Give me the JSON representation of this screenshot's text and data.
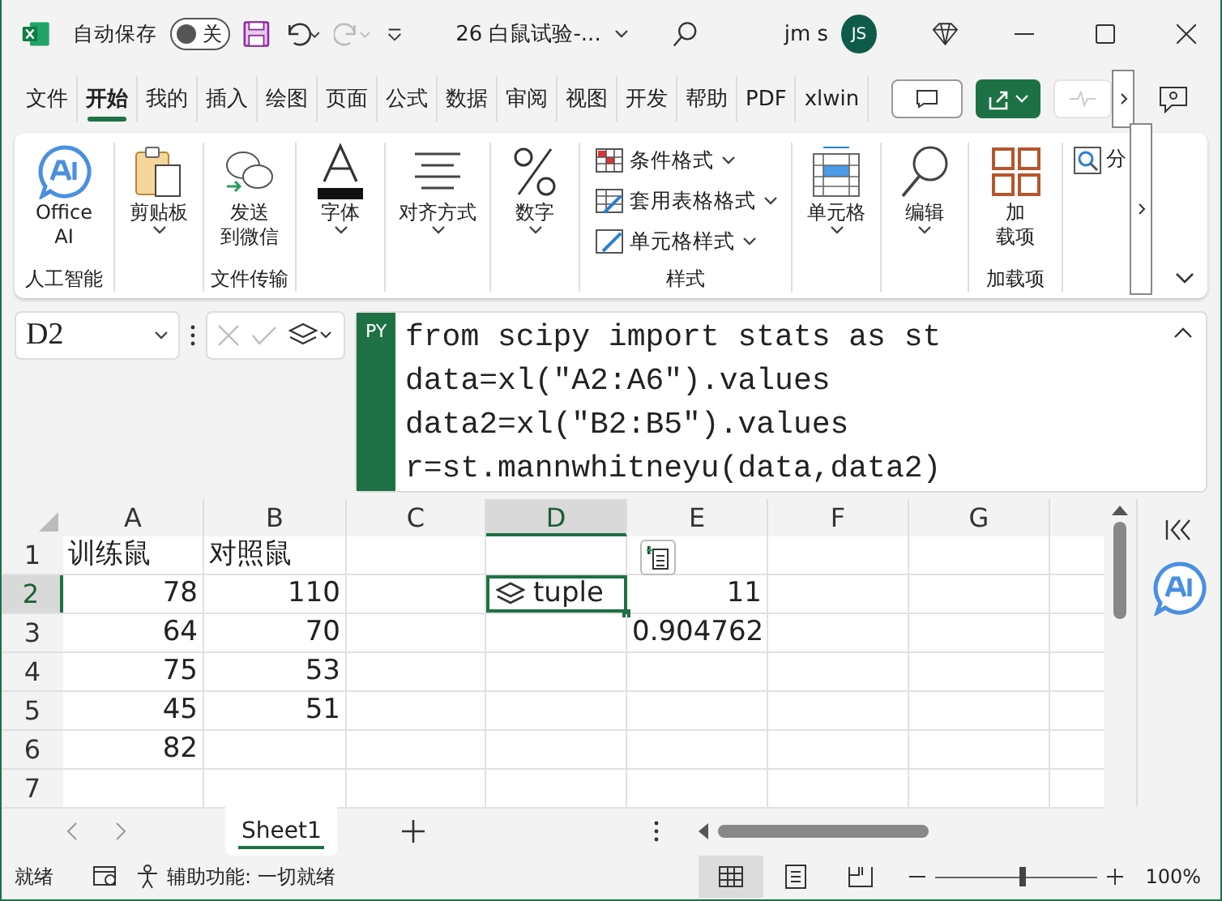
{
  "title_bar": {
    "autosave_label": "自动保存",
    "autosave": {
      "label": "关",
      "on": false
    },
    "filename": "26 白鼠试验-...",
    "user": "jm s",
    "avatar": "JS"
  },
  "tabs": [
    {
      "label": "文件",
      "selected": false
    },
    {
      "label": "开始",
      "selected": true
    },
    {
      "label": "我的",
      "selected": false
    },
    {
      "label": "插入",
      "selected": false
    },
    {
      "label": "绘图",
      "selected": false
    },
    {
      "label": "页面",
      "selected": false
    },
    {
      "label": "公式",
      "selected": false
    },
    {
      "label": "数据",
      "selected": false
    },
    {
      "label": "审阅",
      "selected": false
    },
    {
      "label": "视图",
      "selected": false
    },
    {
      "label": "开发",
      "selected": false
    },
    {
      "label": "帮助",
      "selected": false
    },
    {
      "label": "PDF",
      "selected": false
    },
    {
      "label": "xlwin",
      "selected": false
    }
  ],
  "ribbon": {
    "groups": [
      {
        "label": "人工智能",
        "items": [
          {
            "kind": "large",
            "lines": [
              "Office",
              "AI"
            ]
          }
        ]
      },
      {
        "items": [
          {
            "kind": "dropdown",
            "lines": [
              "剪贴板"
            ]
          }
        ]
      },
      {
        "label": "文件传输",
        "items": [
          {
            "kind": "large",
            "lines": [
              "发送",
              "到微信"
            ]
          }
        ]
      },
      {
        "items": [
          {
            "kind": "dropdown",
            "lines": [
              "字体"
            ]
          }
        ]
      },
      {
        "items": [
          {
            "kind": "dropdown",
            "lines": [
              "对齐方式"
            ]
          }
        ]
      },
      {
        "items": [
          {
            "kind": "dropdown",
            "lines": [
              "数字"
            ]
          }
        ]
      },
      {
        "label": "样式",
        "items": [
          {
            "kind": "small",
            "lines": [
              "条件格式"
            ]
          },
          {
            "kind": "small",
            "lines": [
              "套用表格格式"
            ]
          },
          {
            "kind": "small",
            "lines": [
              "单元格样式"
            ]
          }
        ]
      },
      {
        "items": [
          {
            "kind": "dropdown",
            "lines": [
              "单元格"
            ]
          }
        ]
      },
      {
        "items": [
          {
            "kind": "dropdown",
            "lines": [
              "编辑"
            ]
          }
        ]
      },
      {
        "label": "加载项",
        "items": [
          {
            "kind": "large",
            "lines": [
              "加",
              "载项"
            ]
          }
        ]
      },
      {
        "items": [
          {
            "kind": "partial",
            "lines": [
              "分"
            ]
          }
        ]
      }
    ]
  },
  "formula_bar": {
    "name_box": "D2",
    "badge": "PY",
    "code": [
      "from scipy import stats as st",
      "data=xl(\"A2:A6\").values",
      "data2=xl(\"B2:B5\").values",
      "r=st.mannwhitneyu(data,data2)"
    ]
  },
  "sheet": {
    "columns": [
      {
        "label": "A",
        "selected": false
      },
      {
        "label": "B",
        "selected": false
      },
      {
        "label": "C",
        "selected": false
      },
      {
        "label": "D",
        "selected": true
      },
      {
        "label": "E",
        "selected": false
      },
      {
        "label": "F",
        "selected": false
      },
      {
        "label": "G",
        "selected": false
      }
    ],
    "rows": [
      {
        "label": "1",
        "selected": false,
        "cells": [
          {
            "kind": "text",
            "text": "训练鼠",
            "selected": false
          },
          {
            "kind": "text",
            "text": "对照鼠",
            "selected": false
          }
        ]
      },
      {
        "label": "2",
        "selected": true,
        "cells": [
          {
            "kind": "number",
            "text": "78",
            "selected": false
          },
          {
            "kind": "number",
            "text": "110",
            "selected": false
          },
          {
            "kind": "blank",
            "selected": false
          },
          {
            "kind": "object",
            "text": "tuple",
            "selected": true
          },
          {
            "kind": "number",
            "text": "11",
            "selected": false
          }
        ]
      },
      {
        "label": "3",
        "selected": false,
        "cells": [
          {
            "kind": "number",
            "text": "64",
            "selected": false
          },
          {
            "kind": "number",
            "text": "70",
            "selected": false
          },
          {
            "kind": "blank",
            "selected": false
          },
          {
            "kind": "blank",
            "selected": false
          },
          {
            "kind": "number",
            "text": "0.904762",
            "selected": false
          }
        ]
      },
      {
        "label": "4",
        "selected": false,
        "cells": [
          {
            "kind": "number",
            "text": "75",
            "selected": false
          },
          {
            "kind": "number",
            "text": "53",
            "selected": false
          }
        ]
      },
      {
        "label": "5",
        "selected": false,
        "cells": [
          {
            "kind": "number",
            "text": "45",
            "selected": false
          },
          {
            "kind": "number",
            "text": "51",
            "selected": false
          }
        ]
      },
      {
        "label": "6",
        "selected": false,
        "cells": [
          {
            "kind": "number",
            "text": "82",
            "selected": false
          }
        ]
      },
      {
        "label": "7",
        "selected": false
      }
    ]
  },
  "sheet_tabs": [
    {
      "label": "Sheet1",
      "selected": true
    }
  ],
  "status_bar": {
    "mode": "就绪",
    "accessibility": "辅助功能: 一切就绪",
    "views": [
      {
        "selected": true
      },
      {
        "selected": false
      },
      {
        "selected": false
      }
    ],
    "zoom": {
      "level": 0.52,
      "reading": "100%"
    }
  }
}
